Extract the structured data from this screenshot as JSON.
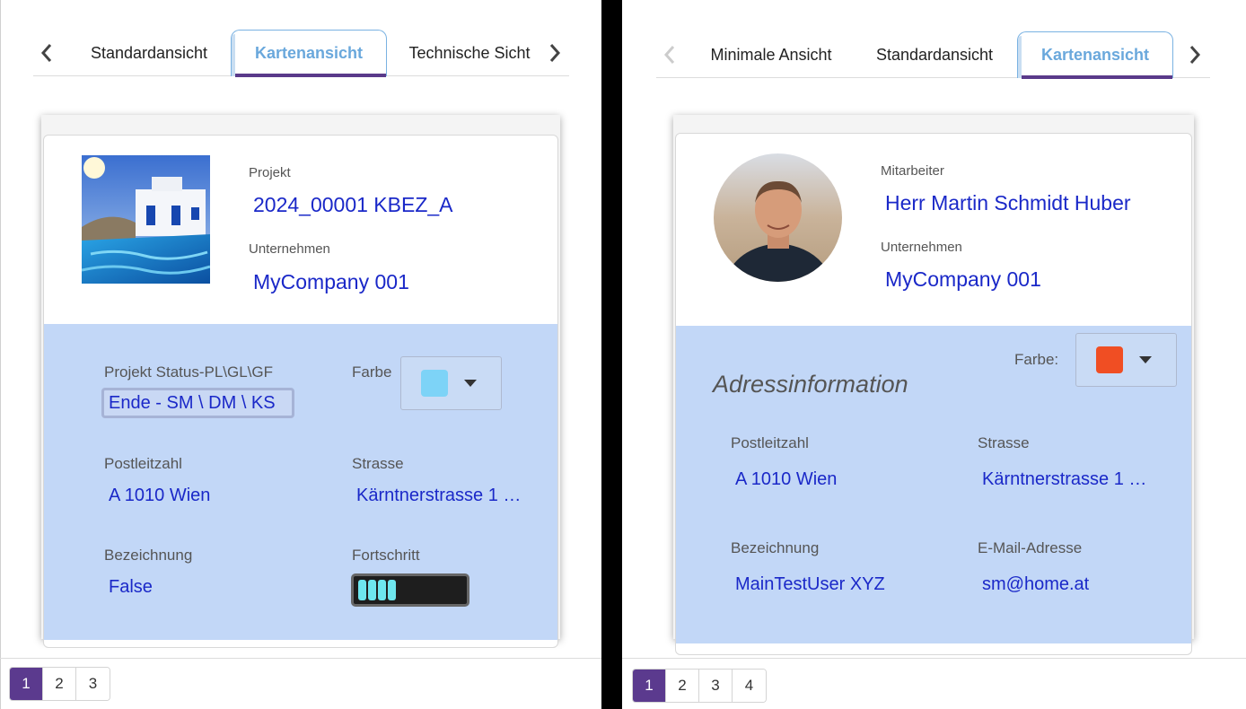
{
  "left": {
    "tabs": [
      "Standardansicht",
      "Kartenansicht",
      "Technische Sicht"
    ],
    "active_tab": "Kartenansicht",
    "card": {
      "project_label": "Projekt",
      "project_value": "2024_00001 KBEZ_A",
      "company_label": "Unternehmen",
      "company_value": "MyCompany 001",
      "status_label": "Projekt Status-PL\\GL\\GF",
      "status_value": "Ende - SM \\ DM \\ KS",
      "color_label": "Farbe",
      "color_hex": "#7dd3f7",
      "zip_label": "Postleitzahl",
      "zip_value": "A 1010 Wien",
      "street_label": "Strasse",
      "street_value": "Kärntnerstrasse 1 …",
      "desc_label": "Bezeichnung",
      "desc_value": "False",
      "progress_label": "Fortschritt",
      "progress_value": 0.25
    },
    "pages": [
      "1",
      "2",
      "3"
    ],
    "active_page": "1"
  },
  "right": {
    "tabs": [
      "Minimale Ansicht",
      "Standardansicht",
      "Kartenansicht"
    ],
    "active_tab": "Kartenansicht",
    "card": {
      "employee_label": "Mitarbeiter",
      "employee_value": "Herr Martin Schmidt Huber",
      "company_label": "Unternehmen",
      "company_value": "MyCompany 001",
      "color_label": "Farbe:",
      "color_hex": "#f04e23",
      "section_title": "Adressinformation",
      "zip_label": "Postleitzahl",
      "zip_value": "A 1010 Wien",
      "street_label": "Strasse",
      "street_value": "Kärntnerstrasse 1 …",
      "desc_label": "Bezeichnung",
      "desc_value": "MainTestUser XYZ",
      "email_label": "E-Mail-Adresse",
      "email_value": "sm@home.at"
    },
    "pages": [
      "1",
      "2",
      "3",
      "4"
    ],
    "active_page": "1"
  },
  "colors": {
    "accent_purple": "#5b3a8e",
    "tab_active_text": "#6aa8dc",
    "value_blue": "#1a28c8",
    "card_blue": "#c2d7f7"
  }
}
